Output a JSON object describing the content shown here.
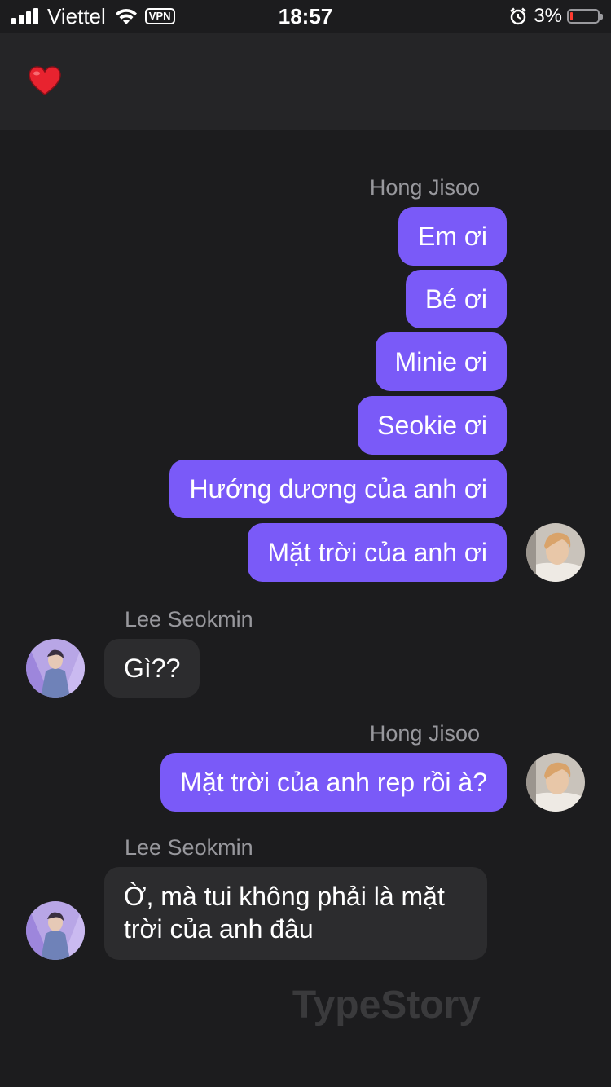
{
  "status_bar": {
    "carrier": "Viettel",
    "vpn": "VPN",
    "time": "18:57",
    "battery_percent": "3%",
    "battery_level": 0.03,
    "battery_color": "#ff3b30"
  },
  "header": {
    "icon": "heart-icon"
  },
  "colors": {
    "outgoing_bubble": "#7a5af8",
    "incoming_bubble": "#2c2c2e",
    "background": "#1c1c1e",
    "name_text": "#98989d"
  },
  "messages": {
    "group1": {
      "sender": "Hong Jisoo",
      "m1": "Em ơi",
      "m2": "Bé ơi",
      "m3": "Minie ơi",
      "m4": "Seokie ơi",
      "m5": "Hướng dương của anh ơi",
      "m6": "Mặt trời của anh ơi"
    },
    "group2": {
      "sender": "Lee Seokmin",
      "m1": "Gì??"
    },
    "group3": {
      "sender": "Hong Jisoo",
      "m1": "Mặt trời của anh rep rồi à?"
    },
    "group4": {
      "sender": "Lee Seokmin",
      "m1": "Ờ, mà tui không phải là mặt trời của anh đâu"
    }
  },
  "watermark": "TypeStory"
}
